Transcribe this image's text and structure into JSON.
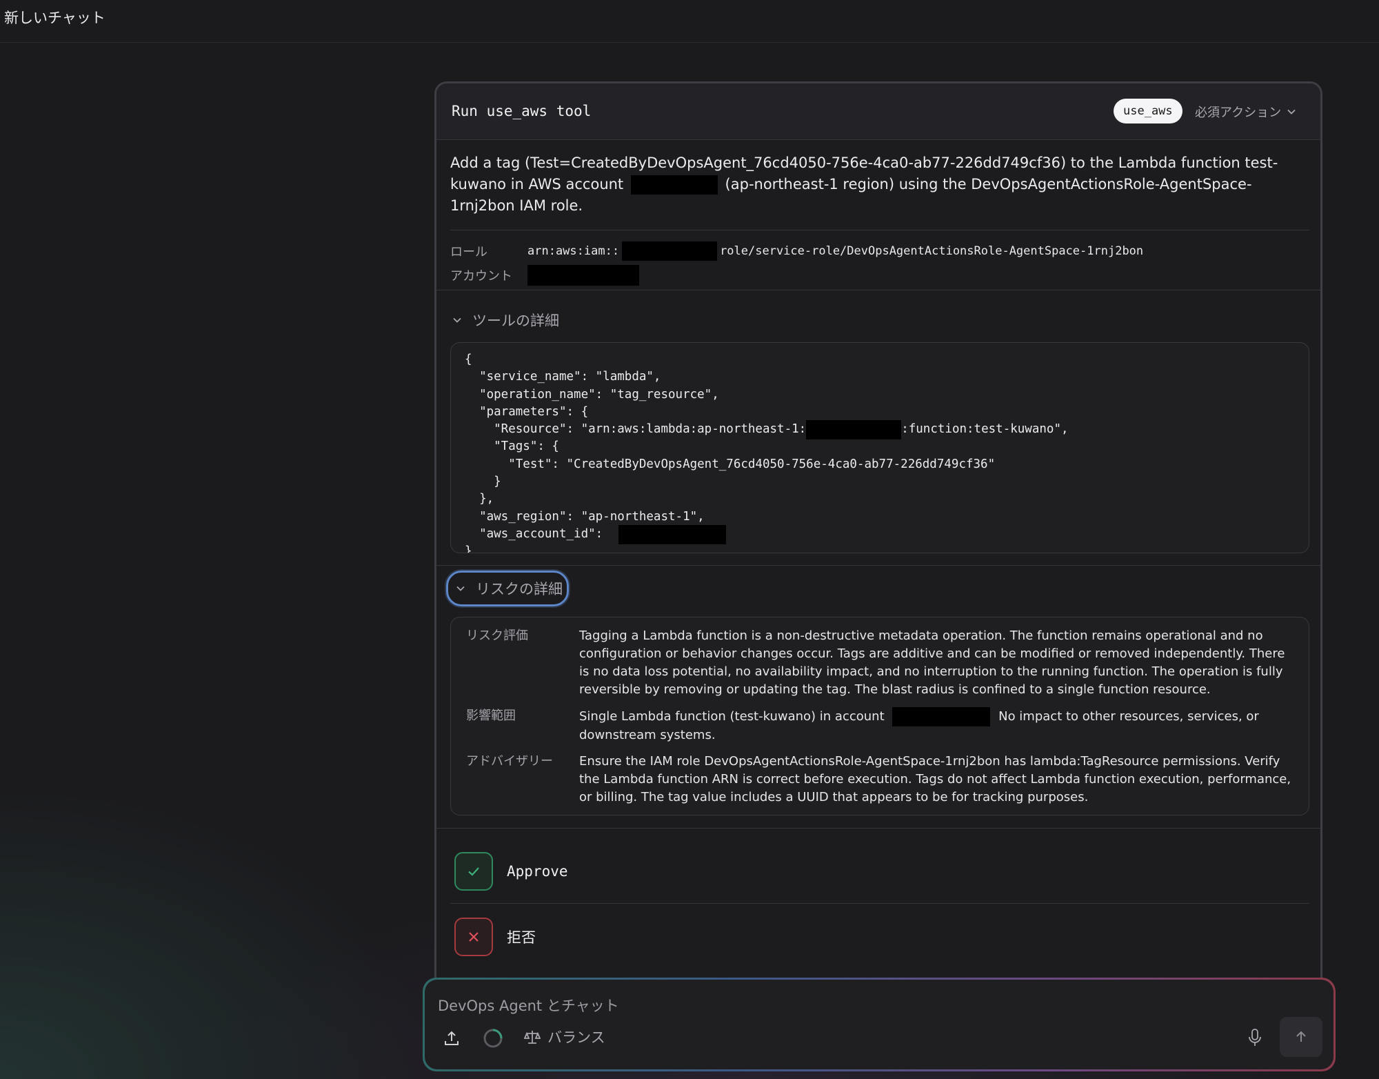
{
  "window": {
    "title": "新しいチャット"
  },
  "card": {
    "title": "Run use_aws tool",
    "tool_pill": "use_aws",
    "required_action": "必須アクション",
    "description_parts": [
      "Add a tag (Test=CreatedByDevOpsAgent_76cd4050-756e-4ca0-ab77-226dd749cf36) to the Lambda function test-kuwano in AWS account",
      "(ap-northeast-1 region) using the DevOpsAgentActionsRole-AgentSpace-1rnj2bon IAM role."
    ],
    "meta": {
      "role_label": "ロール",
      "role_value_prefix": "arn:aws:iam::",
      "role_value_suffix": "role/service-role/DevOpsAgentActionsRole-AgentSpace-1rnj2bon",
      "account_label": "アカウント"
    },
    "tool_details_label": "ツールの詳細",
    "code_lines": [
      "{",
      "  \"service_name\": \"lambda\",",
      "  \"operation_name\": \"tag_resource\",",
      "  \"parameters\": {",
      "    \"Resource\": \"arn:aws:lambda:ap-northeast-1:",
      "    \"Tags\": {",
      "      \"Test\": \"CreatedByDevOpsAgent_76cd4050-756e-4ca0-ab77-226dd749cf36\"",
      "    }",
      "  },",
      "  \"aws_region\": \"ap-northeast-1\",",
      "  \"aws_account_id\": ",
      "}"
    ],
    "code_resource_suffix": ":function:test-kuwano\",",
    "risk_details_label": "リスクの詳細",
    "risk": {
      "assessment_label": "リスク評価",
      "assessment_text": "Tagging a Lambda function is a non-destructive metadata operation. The function remains operational and no configuration or behavior changes occur. Tags are additive and can be modified or removed independently. There is no data loss potential, no availability impact, and no interruption to the running function. The operation is fully reversible by removing or updating the tag. The blast radius is confined to a single function resource.",
      "scope_label": "影響範囲",
      "scope_text_before": "Single Lambda function (test-kuwano) in account",
      "scope_text_after": "No impact to other resources, services, or downstream systems.",
      "advisory_label": "アドバイザリー",
      "advisory_text": "Ensure the IAM role DevOpsAgentActionsRole-AgentSpace-1rnj2bon has lambda:TagResource permissions. Verify the Lambda function ARN is correct before execution. Tags do not affect Lambda function execution, performance, or billing. The tag value includes a UUID that appears to be for tracking purposes."
    },
    "approve_label": "Approve",
    "reject_label": "拒否"
  },
  "chat": {
    "placeholder": "DevOps Agent とチャット",
    "mode_label": "バランス"
  },
  "colors": {
    "approve": "#2e8a5c",
    "reject": "#a53a3f",
    "focus_ring": "#5c86c8"
  },
  "icons": [
    "chevron-down-icon",
    "check-icon",
    "close-icon",
    "upload-icon",
    "spinner-icon",
    "scale-icon",
    "microphone-icon",
    "arrow-up-icon"
  ]
}
